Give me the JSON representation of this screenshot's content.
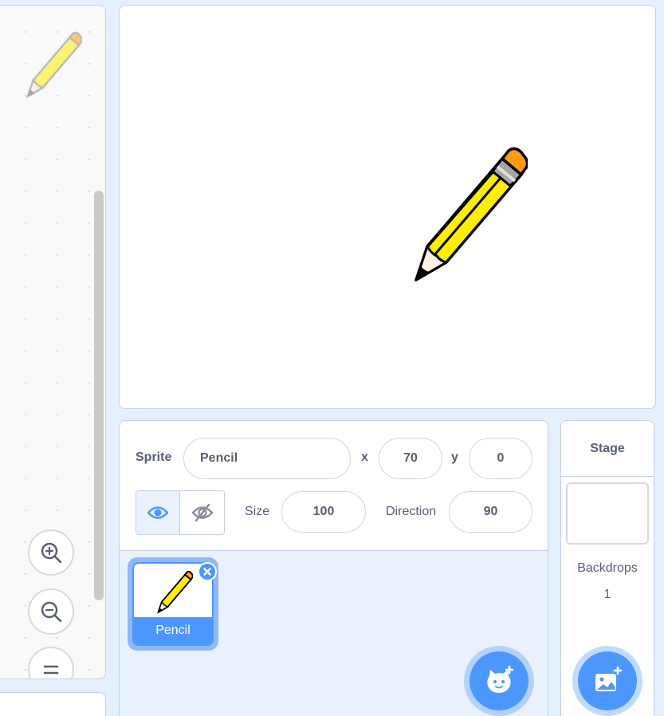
{
  "workspace": {
    "zoom_in_icon": "zoom-in-icon",
    "zoom_out_icon": "zoom-out-icon",
    "zoom_reset_icon": "zoom-reset-icon"
  },
  "sprite_info": {
    "sprite_label": "Sprite",
    "sprite_name": "Pencil",
    "x_label": "x",
    "x_value": "70",
    "y_label": "y",
    "y_value": "0",
    "size_label": "Size",
    "size_value": "100",
    "direction_label": "Direction",
    "direction_value": "90"
  },
  "sprite_list": [
    {
      "name": "Pencil",
      "selected": true
    }
  ],
  "stage_selector": {
    "title": "Stage",
    "backdrops_label": "Backdrops",
    "backdrops_count": "1"
  },
  "colors": {
    "accent": "#4c97ff",
    "background": "#e5f0ff",
    "text": "#575e75",
    "pencil_body": "#ffee00",
    "pencil_eraser": "#ff9a12"
  }
}
